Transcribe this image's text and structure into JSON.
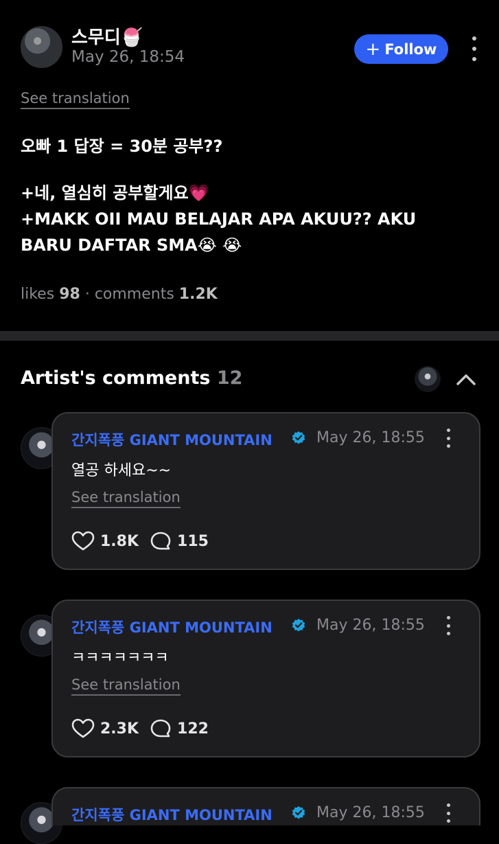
{
  "post": {
    "author": "스무디🍧",
    "date": "May 26, 18:54",
    "follow_label": "Follow",
    "see_translation": "See translation",
    "body_lines": [
      "오빠 1 답장 = 30분 공부??",
      "+네, 열심히 공부할게요💗",
      "+MAKK OII MAU BELAJAR APA AKUU?? AKU",
      "BARU DAFTAR SMA😭 😭"
    ],
    "likes_label": "likes",
    "likes_count": "98",
    "comments_label": "comments",
    "comments_count": "1.2K"
  },
  "artist_comments": {
    "title": "Artist's comments",
    "count": "12",
    "items": [
      {
        "name": "간지폭풍 GIANT MOUNTAIN",
        "date": "May 26, 18:55",
        "text": "열공 하세요~~",
        "see_translation": "See translation",
        "likes": "1.8K",
        "replies": "115"
      },
      {
        "name": "간지폭풍 GIANT MOUNTAIN",
        "date": "May 26, 18:55",
        "text": "ㅋㅋㅋㅋㅋㅋㅋ",
        "see_translation": "See translation",
        "likes": "2.3K",
        "replies": "122"
      },
      {
        "name": "간지폭풍 GIANT MOUNTAIN",
        "date": "May 26, 18:55"
      }
    ]
  },
  "colors": {
    "accent": "#2f5ff2",
    "artist_name": "#3b6cf6",
    "verified_badge": "#1fa3e0",
    "background": "#000000",
    "card": "#1d1d1f"
  },
  "icons": [
    "kebab-icon",
    "plus-icon",
    "chevron-up-icon",
    "verified-badge-icon",
    "heart-icon",
    "comment-bubble-icon"
  ]
}
